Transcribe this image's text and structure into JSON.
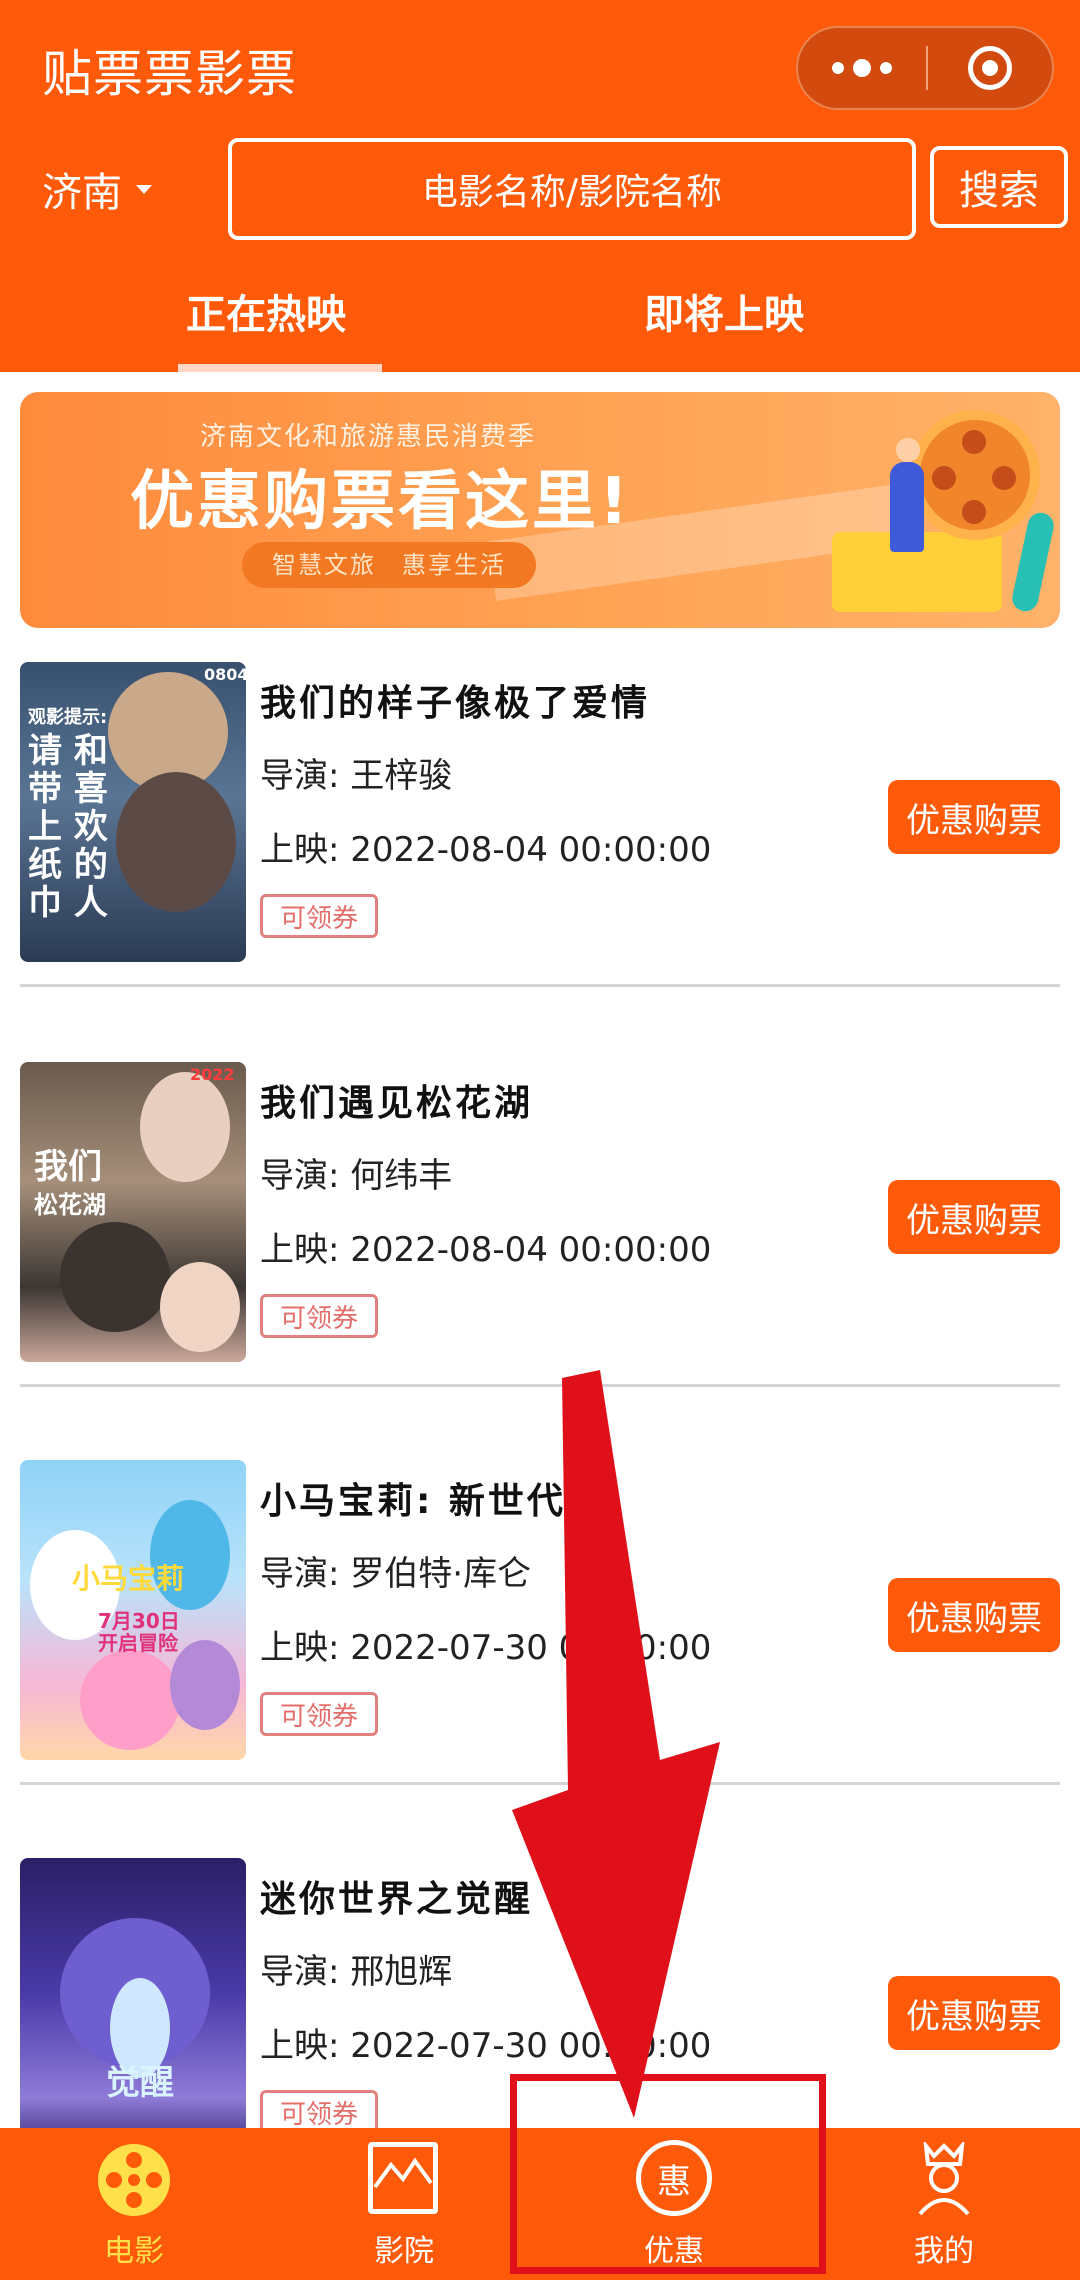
{
  "header": {
    "app_title": "贴票票影票",
    "city": "济南",
    "search_placeholder": "电影名称/影院名称",
    "search_button": "搜索",
    "tabs": [
      {
        "label": "正在热映",
        "active": true
      },
      {
        "label": "即将上映",
        "active": false
      }
    ],
    "colors": {
      "brand": "#ff5a0a",
      "accent": "#ffe04a"
    }
  },
  "banner": {
    "subtitle": "济南文化和旅游惠民消费季",
    "title": "优惠购票看这里!",
    "tag": "智慧文旅　惠享生活"
  },
  "labels": {
    "director_prefix": "导演: ",
    "release_prefix": "上映: ",
    "coupon": "可领券",
    "buy": "优惠购票"
  },
  "movies": [
    {
      "title": "我们的样子像极了爱情",
      "director": "王梓骏",
      "release": "2022-08-04 00:00:00",
      "poster_text": [
        "观影提示:",
        "请 和",
        "带 喜",
        "上 欢",
        "纸 的",
        "巾 人"
      ],
      "poster_badge": "0804"
    },
    {
      "title": "我们遇见松花湖",
      "director": "何纬丰",
      "release": "2022-08-04 00:00:00",
      "poster_text": [
        "我们",
        "松花湖"
      ],
      "poster_badge": "2022"
    },
    {
      "title": "小马宝莉: 新世代",
      "director": "罗伯特·库仑",
      "release": "2022-07-30 00:00:00",
      "poster_text": [
        "小马宝莉",
        "7月30日",
        "开启冒险"
      ],
      "poster_badge": ""
    },
    {
      "title": "迷你世界之觉醒",
      "director": "邢旭辉",
      "release": "2022-07-30 00:00:00",
      "poster_text": [
        "觉醒"
      ],
      "poster_badge": ""
    }
  ],
  "bottom_nav": [
    {
      "label": "电影",
      "icon": "film-reel-icon",
      "active": true
    },
    {
      "label": "影院",
      "icon": "cinema-icon",
      "active": false
    },
    {
      "label": "优惠",
      "icon": "discount-icon",
      "active": false,
      "glyph": "惠"
    },
    {
      "label": "我的",
      "icon": "profile-icon",
      "active": false
    }
  ]
}
